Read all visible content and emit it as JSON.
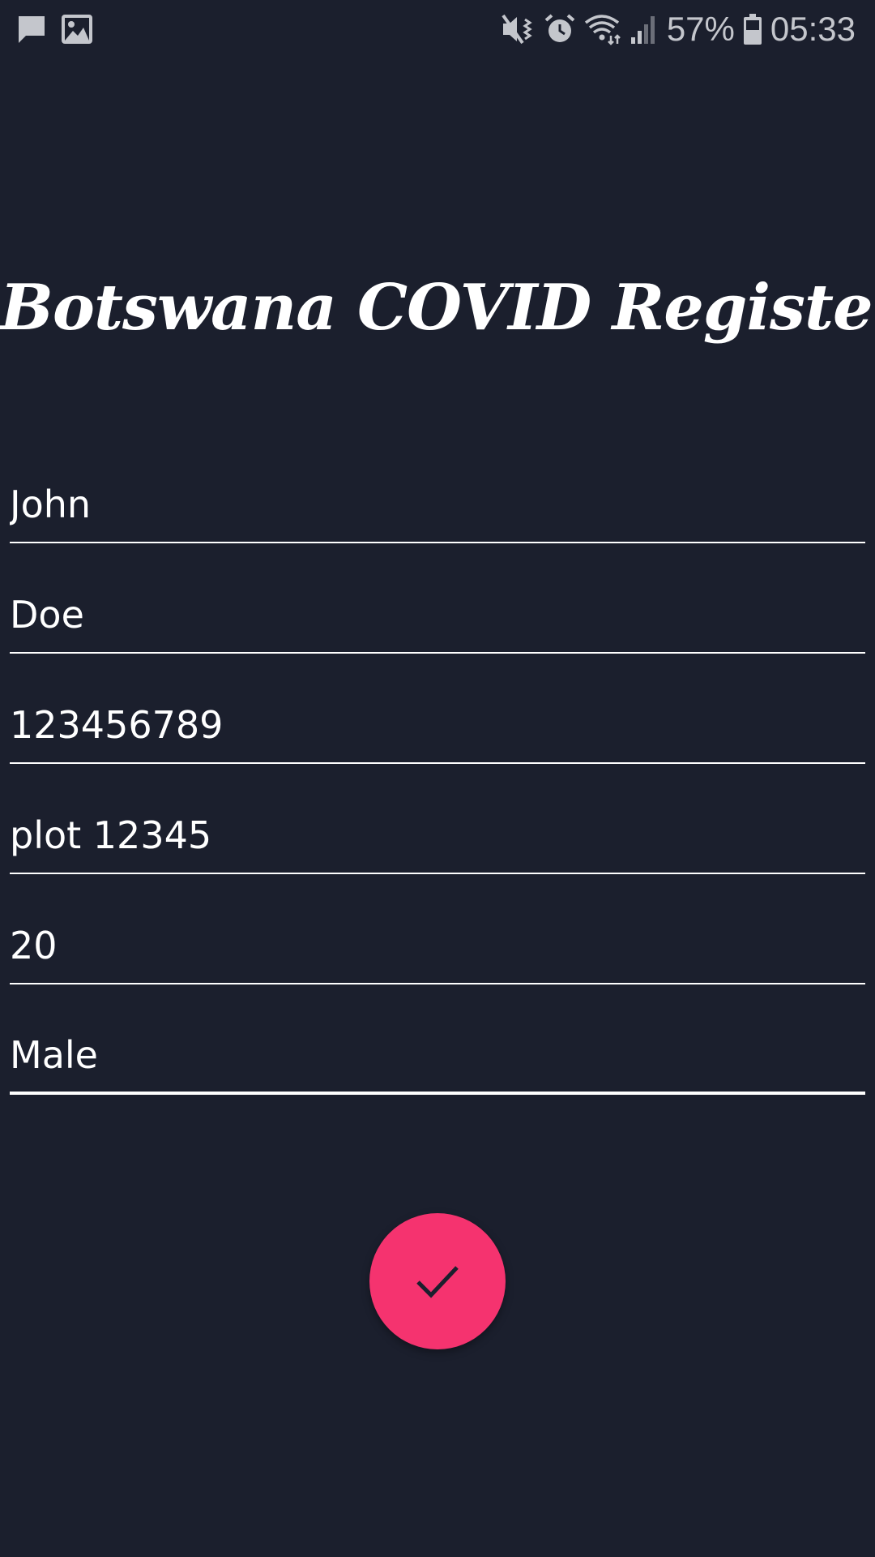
{
  "status_bar": {
    "left_icons": [
      "message-icon",
      "image-icon"
    ],
    "right_icons": [
      "mute-vibrate-icon",
      "alarm-icon",
      "wifi-icon",
      "cellular-signal-icon",
      "battery-icon"
    ],
    "battery_percent": "57%",
    "time": "05:33"
  },
  "app": {
    "title": "Botswana COVID Register"
  },
  "form": {
    "fields": [
      {
        "value": "John"
      },
      {
        "value": "Doe"
      },
      {
        "value": "123456789"
      },
      {
        "value": "plot 12345"
      },
      {
        "value": "20"
      },
      {
        "value": "Male"
      }
    ],
    "focused_index": 5
  },
  "fab": {
    "icon": "check-icon"
  },
  "colors": {
    "background": "#1b1f2d",
    "text": "#ffffff",
    "status_text": "#c4c6cc",
    "accent": "#f5336f"
  }
}
